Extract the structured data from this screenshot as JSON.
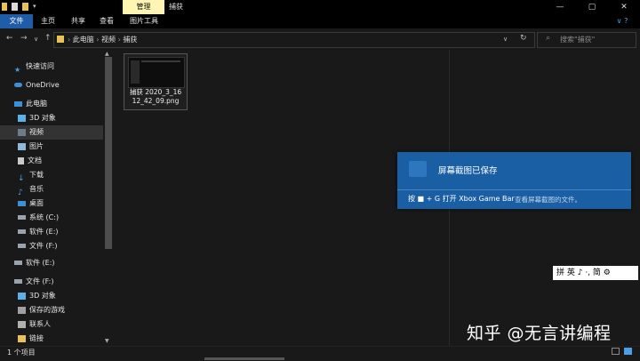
{
  "window": {
    "title": "捕获",
    "controls": [
      "—",
      "▢",
      "✕"
    ]
  },
  "ribbon": {
    "tabs": [
      "文件",
      "主页",
      "共享",
      "查看",
      "图片工具"
    ],
    "manage_label": "管理"
  },
  "address": {
    "crumbs": [
      "此电脑",
      "视频",
      "捕获"
    ],
    "search_placeholder": "搜索\"捕获\""
  },
  "nav": {
    "items": [
      {
        "label": "快速访问",
        "icon": "star-icon"
      },
      {
        "label": "OneDrive",
        "icon": "cloud-icon"
      },
      {
        "label": "此电脑",
        "icon": "computer-icon"
      },
      {
        "label": "3D 对象",
        "icon": "cube-icon"
      },
      {
        "label": "视频",
        "icon": "video-icon"
      },
      {
        "label": "图片",
        "icon": "picture-icon"
      },
      {
        "label": "文档",
        "icon": "document-icon"
      },
      {
        "label": "下载",
        "icon": "download-icon"
      },
      {
        "label": "音乐",
        "icon": "music-icon"
      },
      {
        "label": "桌面",
        "icon": "desktop-icon"
      },
      {
        "label": "系统 (C:)",
        "icon": "drive-icon"
      },
      {
        "label": "软件 (E:)",
        "icon": "drive-icon"
      },
      {
        "label": "文件 (F:)",
        "icon": "drive-icon"
      },
      {
        "label": "软件 (E:)",
        "icon": "drive-icon"
      },
      {
        "label": "文件 (F:)",
        "icon": "drive-icon"
      },
      {
        "label": "3D 对象",
        "icon": "cube-icon"
      },
      {
        "label": "保存的游戏",
        "icon": "game-icon"
      },
      {
        "label": "联系人",
        "icon": "contacts-icon"
      },
      {
        "label": "链接",
        "icon": "link-icon"
      }
    ]
  },
  "file": {
    "name": "捕获 2020_3_16 12_42_09.png"
  },
  "toast": {
    "title": "屏幕截图已保存",
    "body": "按 ■ + G 打开 Xbox Game Bar",
    "sub": "查看屏幕截图的文件。"
  },
  "ime": {
    "text": "拼 英 ♪ ·, 简 ⚙"
  },
  "watermark": "知乎 @无言讲编程",
  "status": {
    "count": "1 个项目"
  },
  "colors": {
    "accent": "#1f5da8",
    "toast": "#1a5ea3",
    "manage": "#fff5b3"
  }
}
